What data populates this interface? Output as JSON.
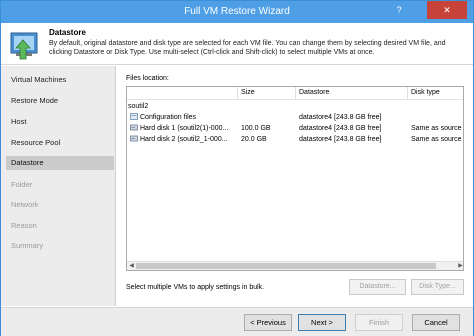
{
  "window": {
    "title": "Full VM Restore Wizard",
    "help": "?",
    "close": "✕"
  },
  "header": {
    "title": "Datastore",
    "description": "By default, original datastore and disk type are selected for each VM file. You can change them by selecting desired VM file, and clicking Datastore or Disk Type. Use multi-select (Ctrl-click and Shift-click) to select multiple VMs at once."
  },
  "sidebar": {
    "steps": [
      {
        "label": "Virtual Machines"
      },
      {
        "label": "Restore Mode"
      },
      {
        "label": "Host"
      },
      {
        "label": "Resource Pool"
      },
      {
        "label": "Datastore"
      },
      {
        "label": "Folder"
      },
      {
        "label": "Network"
      },
      {
        "label": "Reason"
      },
      {
        "label": "Summary"
      }
    ]
  },
  "files": {
    "label": "Files location:",
    "columns": [
      "",
      "Size",
      "Datastore",
      "Disk type"
    ],
    "group": "soutil2",
    "rows": [
      {
        "name": "Configuration files",
        "size": "",
        "datastore": "datastore4 [243.8 GB free]",
        "disk_type": ""
      },
      {
        "name": "Hard disk 1 (soutil2(1)-000...",
        "size": "100.0 GB",
        "datastore": "datastore4 [243.8 GB free]",
        "disk_type": "Same as source"
      },
      {
        "name": "Hard disk 2 (soutil2_1-000...",
        "size": "20.0 GB",
        "datastore": "datastore4 [243.8 GB free]",
        "disk_type": "Same as source"
      }
    ]
  },
  "bulk": {
    "text": "Select multiple VMs to apply settings in bulk.",
    "datastore_button": "Datastore...",
    "disktype_button": "Disk Type..."
  },
  "footer": {
    "previous": "< Previous",
    "next": "Next >",
    "finish": "Finish",
    "cancel": "Cancel"
  },
  "colors": {
    "titlebar": "#4f9fe6",
    "close": "#c7433a",
    "sidebar": "#ececec",
    "active_step": "#cbcbcb"
  }
}
